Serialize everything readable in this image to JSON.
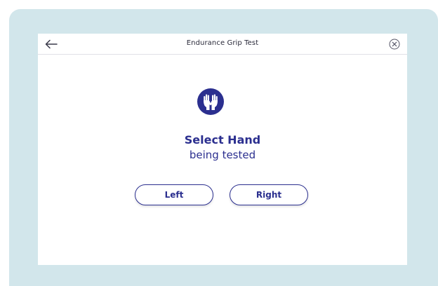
{
  "header": {
    "title": "Endurance Grip Test",
    "back_icon": "arrow-left-icon",
    "close_icon": "close-circle-icon"
  },
  "main": {
    "icon": "hands-icon",
    "heading": "Select Hand",
    "subheading": "being tested",
    "buttons": {
      "left_label": "Left",
      "right_label": "Right"
    }
  },
  "colors": {
    "accent": "#2b2f8f",
    "frame_background": "#d2e6eb",
    "screen_background": "#ffffff"
  }
}
